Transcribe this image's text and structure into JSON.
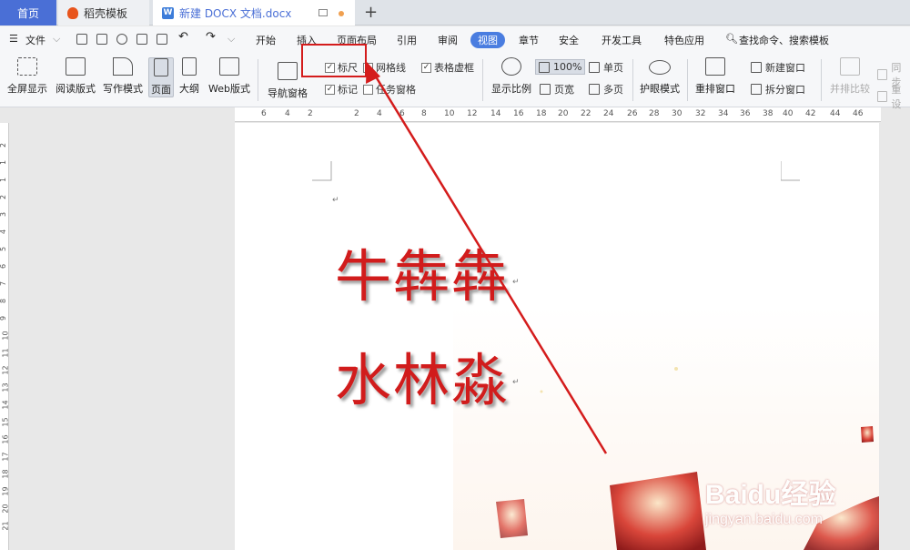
{
  "tabs": [
    {
      "label": "首页"
    },
    {
      "label": "稻壳模板"
    },
    {
      "label": "新建 DOCX 文档.docx"
    }
  ],
  "menu": {
    "file": "文件",
    "items": [
      "开始",
      "插入",
      "页面布局",
      "引用",
      "审阅",
      "视图",
      "章节",
      "安全",
      "开发工具",
      "特色应用"
    ],
    "search": "查找命令、搜索模板"
  },
  "toolbar": {
    "fullscreen": "全屏显示",
    "reading": "阅读版式",
    "writing": "写作模式",
    "page": "页面",
    "outline": "大纲",
    "web": "Web版式",
    "nav": "导航窗格",
    "ruler": "标尺",
    "gridlines": "网格线",
    "table_borders": "表格虚框",
    "markup": "标记",
    "task_pane": "任务窗格",
    "zoom": "显示比例",
    "zoom_value": "100%",
    "single_page": "单页",
    "page_width": "页宽",
    "multi_page": "多页",
    "eye_mode": "护眼模式",
    "rearrange": "重排窗口",
    "new_window": "新建窗口",
    "split": "拆分窗口",
    "compare": "并排比较",
    "sync": "同步",
    "reset": "重设"
  },
  "ruler_numbers": [
    "6",
    "4",
    "2",
    "2",
    "4",
    "6",
    "8",
    "10",
    "12",
    "14",
    "16",
    "18",
    "20",
    "22",
    "24",
    "26",
    "28",
    "30",
    "32",
    "34",
    "36",
    "38",
    "40",
    "42",
    "44",
    "46"
  ],
  "vruler_numbers": [
    "2",
    "1",
    "1",
    "2",
    "3",
    "4",
    "5",
    "6",
    "7",
    "8",
    "9",
    "10",
    "11",
    "12",
    "13",
    "14",
    "15",
    "16",
    "17",
    "18",
    "19",
    "20",
    "21"
  ],
  "document": {
    "line1": "牛犇犇",
    "line2": "水林淼",
    "mark": "↵"
  },
  "watermark": {
    "line1": "Baidu经验",
    "line2": "jingyan.baidu.com"
  },
  "colors": {
    "accent": "#4a7de0",
    "text_red": "#d11c1c",
    "annotation": "#d41c1c"
  }
}
